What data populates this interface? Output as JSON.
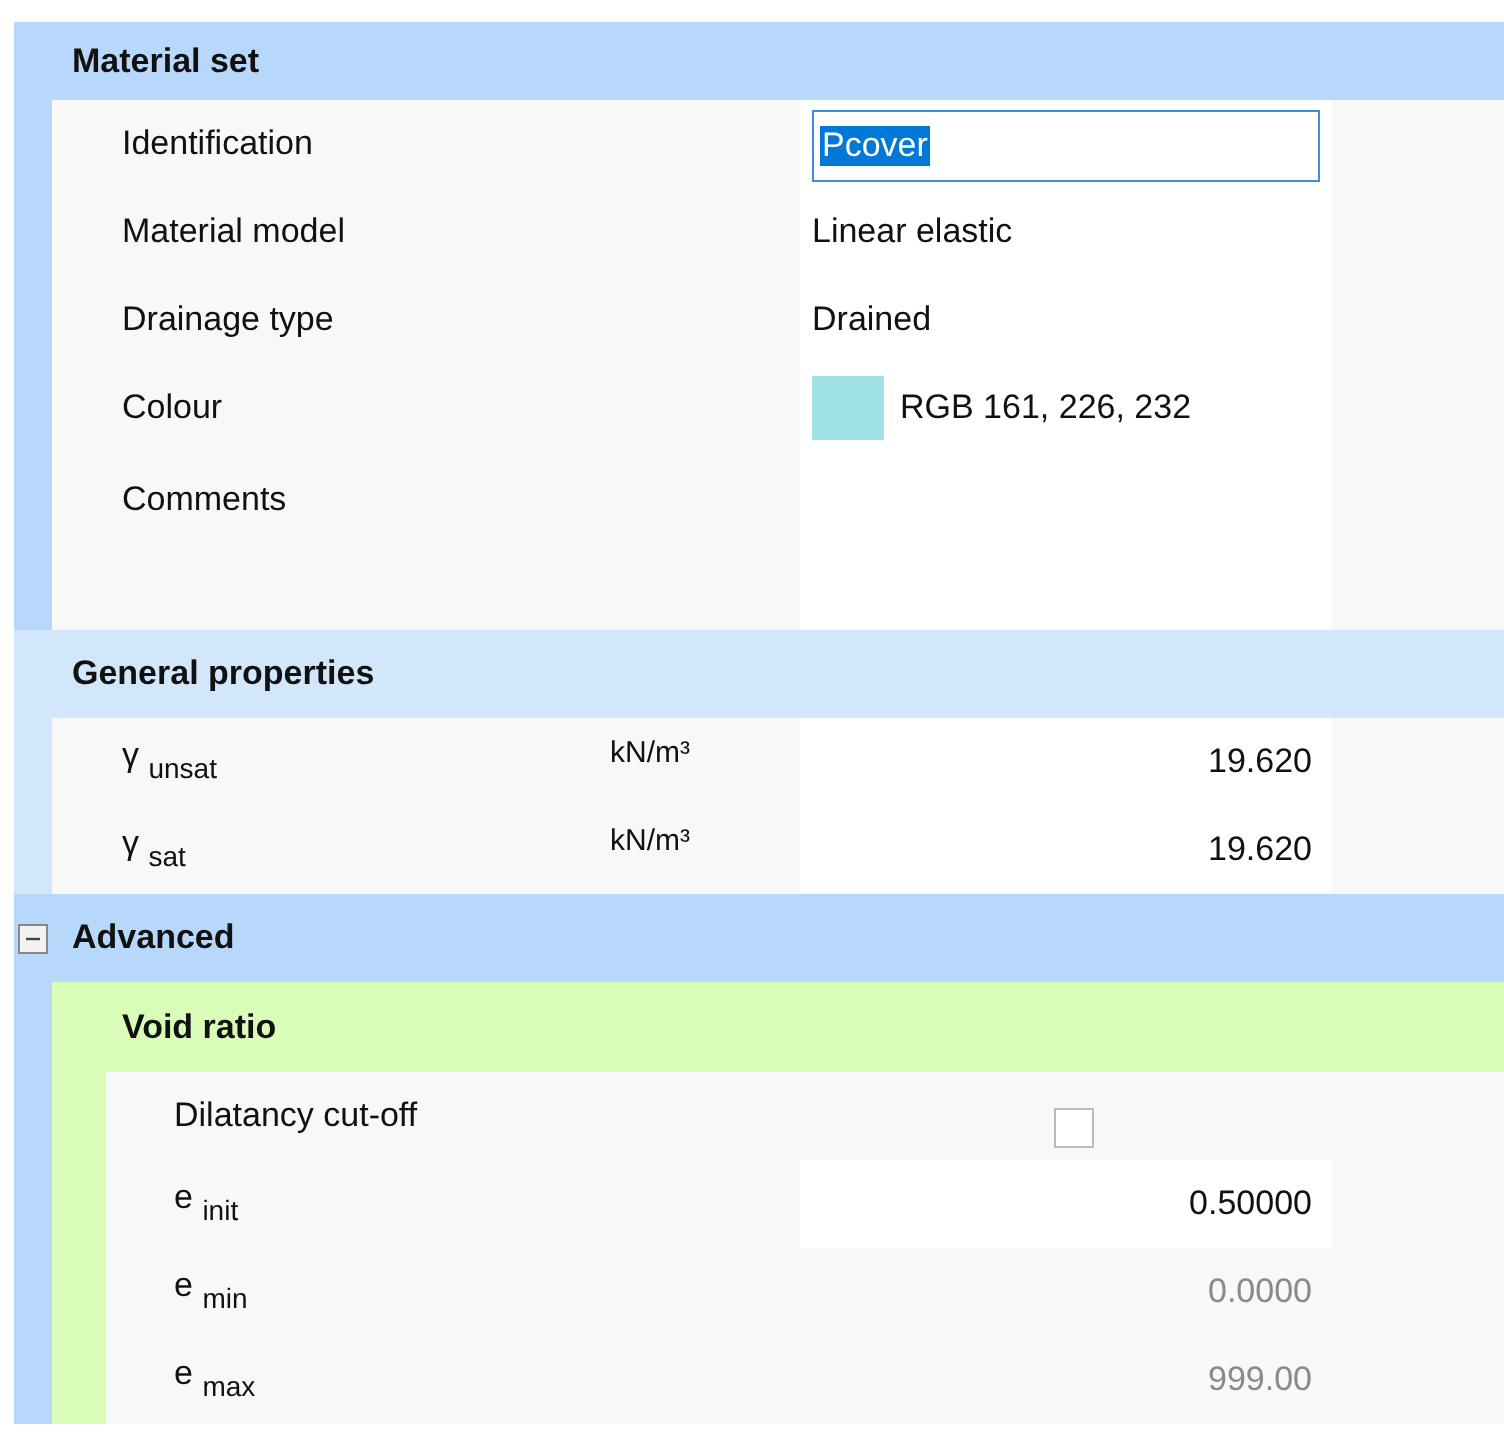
{
  "sections": [
    {
      "title": "Material set",
      "color": "#b8d8fb",
      "rows": [
        {
          "kind": "input",
          "label": "Identification",
          "value": "Pcover",
          "text_selected": true
        },
        {
          "kind": "text",
          "label": "Material model",
          "value": "Linear elastic"
        },
        {
          "kind": "text",
          "label": "Drainage type",
          "value": "Drained"
        },
        {
          "kind": "color",
          "label": "Colour",
          "value": "RGB 161, 226, 232",
          "color": "#a1e2e8"
        },
        {
          "kind": "memo",
          "label": "Comments"
        }
      ]
    },
    {
      "title": "General properties",
      "color": "#d2e6fc",
      "rows": [
        {
          "kind": "number",
          "label": "γ $_{unsat}$",
          "unit": "kN/m³",
          "value": "19.620",
          "disabled": false
        },
        {
          "kind": "number",
          "label": "γ $_{sat}$",
          "unit": "kN/m³",
          "value": "19.620",
          "disabled": false
        }
      ]
    },
    {
      "title": "Advanced",
      "color": "#b8d8fb",
      "expanded": true,
      "subsections": [
        {
          "title": "Void ratio",
          "rows": [
            {
              "kind": "checkbox",
              "label": "Dilatancy cut-off",
              "checked": false
            },
            {
              "kind": "number",
              "label": "e $_{init}$",
              "value": "0.50000",
              "disabled": false
            },
            {
              "kind": "number",
              "label": "e $_{min}$",
              "value": "0.0000",
              "disabled": true
            },
            {
              "kind": "number",
              "label": "e $_{max}$",
              "value": "999.00",
              "disabled": true
            }
          ]
        }
      ]
    }
  ]
}
